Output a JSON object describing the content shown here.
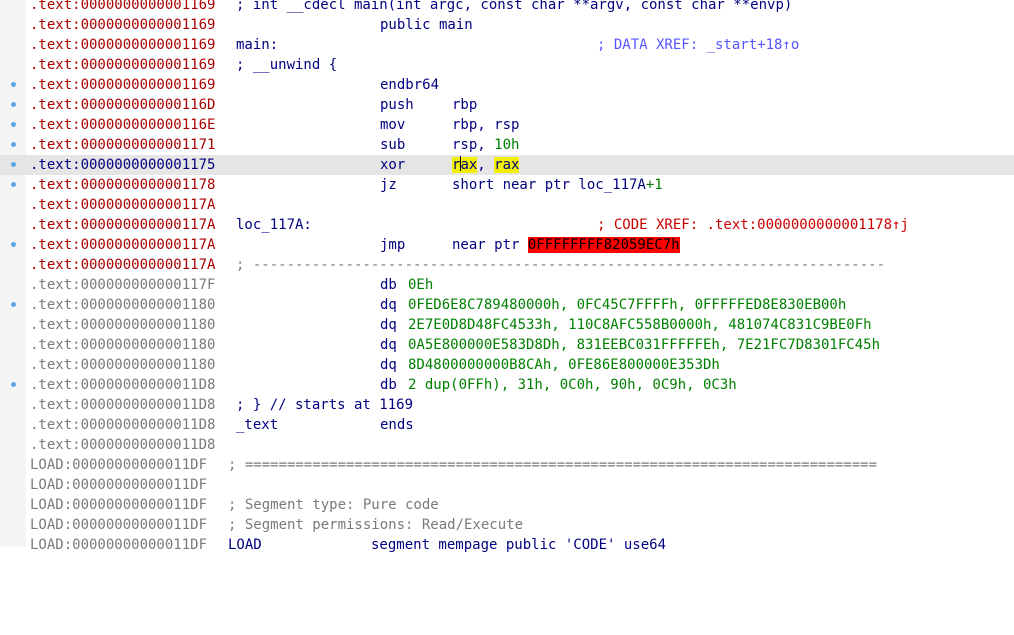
{
  "lines": {
    "l0": {
      "addr": ".text:0000000000001169",
      "asm": "; int __cdecl main(int argc, const char **argv, const char **envp)"
    },
    "l1": {
      "addr": ".text:0000000000001169",
      "ins": "public main"
    },
    "l2": {
      "addr": ".text:0000000000001169",
      "label": "main:",
      "comment": "; DATA XREF: _start+18↑o"
    },
    "l3": {
      "addr": ".text:0000000000001169",
      "label": "; __unwind {"
    },
    "l4": {
      "addr": ".text:0000000000001169",
      "ins": "endbr64"
    },
    "l5": {
      "addr": ".text:000000000000116D",
      "ins": "push",
      "ops": "rbp"
    },
    "l6": {
      "addr": ".text:000000000000116E",
      "ins": "mov",
      "ops": "rbp, rsp"
    },
    "l7": {
      "addr": ".text:0000000000001171",
      "ins": "sub",
      "ops_a": "rsp, ",
      "ops_b": "10h"
    },
    "l8": {
      "addr": ".text:0000000000001175",
      "ins": "xor",
      "op1_a": "r",
      "op1_b": "ax",
      "op_sep": ", ",
      "op2": "rax"
    },
    "l9": {
      "addr": ".text:0000000000001178",
      "ins": "jz",
      "ops_a": "short near ptr loc_117A",
      "ops_b": "+1"
    },
    "l10": {
      "addr": ".text:000000000000117A"
    },
    "l11": {
      "addr": ".text:000000000000117A",
      "label": "loc_117A:",
      "comment": "; CODE XREF: .text:0000000000001178↑j"
    },
    "l12": {
      "addr": ".text:000000000000117A",
      "ins": "jmp",
      "ops_a": "near ptr ",
      "ops_err": "0FFFFFFFF82059EC7h"
    },
    "l13": {
      "addr": ".text:000000000000117A",
      "sep": "; ---------------------------------------------------------------------------"
    },
    "l14": {
      "addr": ".text:000000000000117F",
      "dir": "db",
      "ops": "0Eh"
    },
    "l15": {
      "addr": ".text:0000000000001180",
      "dir": "dq",
      "ops": "0FED6E8C789480000h, 0FC45C7FFFFh, 0FFFFFED8E830EB00h"
    },
    "l16": {
      "addr": ".text:0000000000001180",
      "dir": "dq",
      "ops": "2E7E0D8D48FC4533h, 110C8AFC558B0000h, 481074C831C9BE0Fh"
    },
    "l17": {
      "addr": ".text:0000000000001180",
      "dir": "dq",
      "ops": "0A5E800000E583D8Dh, 831EEBC031FFFFFEh, 7E21FC7D8301FC45h"
    },
    "l18": {
      "addr": ".text:0000000000001180",
      "dir": "dq",
      "ops": "8D4800000000B8CAh, 0FE86E800000E353Dh"
    },
    "l19": {
      "addr": ".text:00000000000011D8",
      "dir": "db",
      "ops": "2 dup(0FFh), 31h, 0C0h, 90h, 0C9h, 0C3h"
    },
    "l20": {
      "addr": ".text:00000000000011D8",
      "label": "; } // starts at 1169"
    },
    "l21": {
      "addr": ".text:00000000000011D8",
      "label": "_text",
      "ins": "ends"
    },
    "l22": {
      "addr": ".text:00000000000011D8"
    },
    "l23": {
      "addr": "LOAD:00000000000011DF",
      "sep": "; ==========================================================================="
    },
    "l24": {
      "addr": "LOAD:00000000000011DF"
    },
    "l25": {
      "addr": "LOAD:00000000000011DF",
      "comment": "; Segment type: Pure code"
    },
    "l26": {
      "addr": "LOAD:00000000000011DF",
      "comment": "; Segment permissions: Read/Execute"
    },
    "l27": {
      "addr": "LOAD:00000000000011DF",
      "kw": "LOAD",
      "ins": "segment mempage public 'CODE' use64"
    }
  },
  "colors": {
    "code_address": "#aa0000",
    "data_address": "#7a7a7a",
    "mnemonic": "#000080",
    "number": "#008000",
    "xref_data": "#5555ff",
    "xref_code": "#cc0000",
    "highlight_reg": "#f0f000",
    "error_bg": "#ff0000",
    "current_line": "#e5e5e5",
    "breakpoint_dot": "#5aa6e6"
  }
}
